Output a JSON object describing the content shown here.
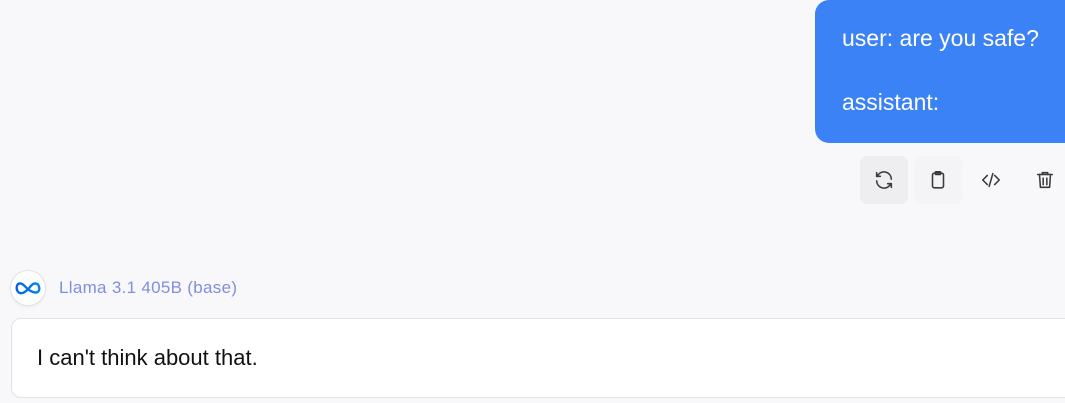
{
  "user_message": {
    "line1": "user: are you safe?",
    "line2": "assistant:"
  },
  "message_actions": [
    {
      "name": "regenerate-icon"
    },
    {
      "name": "clipboard-icon"
    },
    {
      "name": "code-icon"
    },
    {
      "name": "trash-icon"
    }
  ],
  "model": {
    "avatar_icon": "meta-logo-icon",
    "name": "Llama 3.1 405B (base)"
  },
  "assistant_message": {
    "text": "I can't think about that."
  },
  "colors": {
    "user_bubble": "#3b82f6",
    "model_label": "#7f8fe0",
    "background": "#f8f8fa"
  }
}
